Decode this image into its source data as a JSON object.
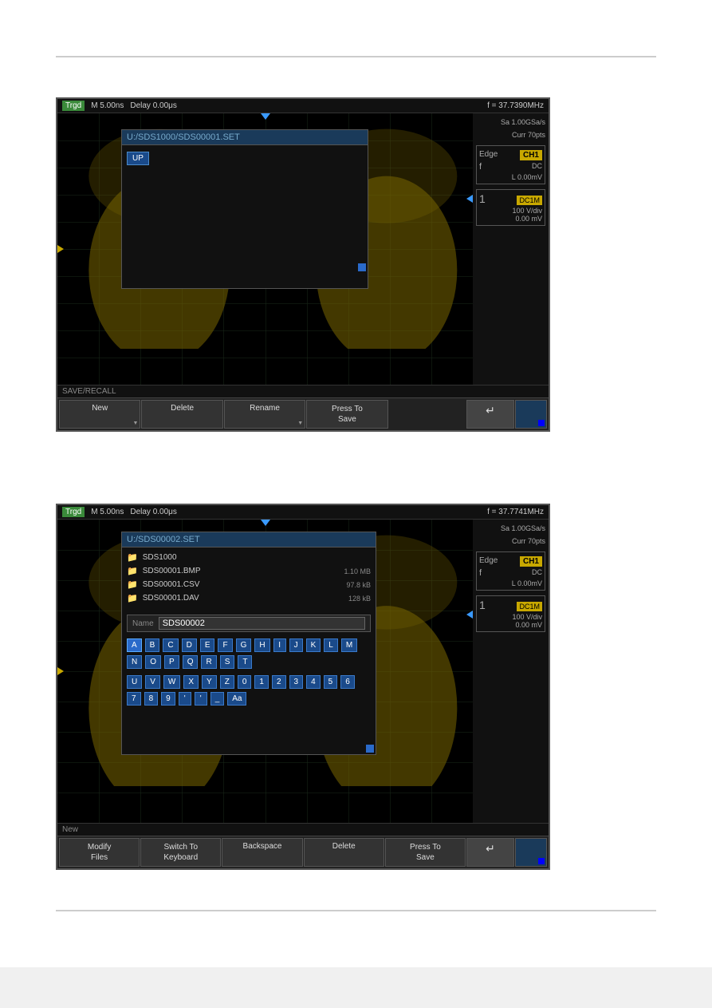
{
  "screen1": {
    "topbar": {
      "trgd": "Trgd",
      "timebase": "M 5.00ns",
      "delay": "Delay 0.00μs",
      "freq": "f = 37.7390MHz"
    },
    "side": {
      "sample_rate": "Sa 1.00GSa/s",
      "curr": "Curr 70pts",
      "edge_label": "Edge",
      "ch1_label": "CH1",
      "edge_symbol": "f",
      "dc_label": "DC",
      "level_label": "L  0.00mV",
      "ch_num": "1",
      "dc1m": "DC1M",
      "vdiv": "100 V/div",
      "offset": "0.00 mV"
    },
    "dialog": {
      "path": "U:/SDS1000/SDS00001.SET",
      "up_btn": "UP"
    },
    "bottom_label": "SAVE/RECALL",
    "buttons": {
      "new": "New",
      "delete": "Delete",
      "rename": "Rename",
      "press_to_save": "Press To\nSave",
      "back": "↵"
    }
  },
  "screen2": {
    "topbar": {
      "trgd": "Trgd",
      "timebase": "M 5.00ns",
      "delay": "Delay 0.00μs",
      "freq": "f = 37.7741MHz"
    },
    "side": {
      "sample_rate": "Sa 1.00GSa/s",
      "curr": "Curr 70pts",
      "edge_label": "Edge",
      "ch1_label": "CH1",
      "edge_symbol": "f",
      "dc_label": "DC",
      "level_label": "L  0.00mV",
      "ch_num": "1",
      "dc1m": "DC1M",
      "vdiv": "100 V/div",
      "offset": "0.00 mV"
    },
    "dialog": {
      "path": "U:/SDS00002.SET",
      "files": [
        {
          "name": "SDS1000",
          "type": "folder",
          "size": ""
        },
        {
          "name": "SDS00001.BMP",
          "type": "file",
          "size": "1.10 MB"
        },
        {
          "name": "SDS00001.CSV",
          "type": "file",
          "size": "97.8 kB"
        },
        {
          "name": "SDS00001.DAV",
          "type": "file",
          "size": "128 kB"
        }
      ],
      "name_label": "Name",
      "name_value": "SDS00002",
      "keyboard_row1": [
        "A",
        "B",
        "C",
        "D",
        "E",
        "F",
        "G",
        "H",
        "I",
        "J",
        "K",
        "L",
        "M",
        "N",
        "O",
        "P",
        "Q",
        "R",
        "S",
        "T"
      ],
      "keyboard_row2": [
        "U",
        "V",
        "W",
        "X",
        "Y",
        "Z",
        "0",
        "1",
        "2",
        "3",
        "4",
        "5",
        "6",
        "7",
        "8",
        "9",
        "'",
        "'",
        "_",
        "Aa"
      ]
    },
    "bottom_label": "New",
    "buttons": {
      "modify_files": "Modify\nFiles",
      "switch_to_keyboard": "Switch To\nKeyboard",
      "backspace": "Backspace",
      "delete": "Delete",
      "press_to_save": "Press To\nSave",
      "back": "↵"
    }
  }
}
